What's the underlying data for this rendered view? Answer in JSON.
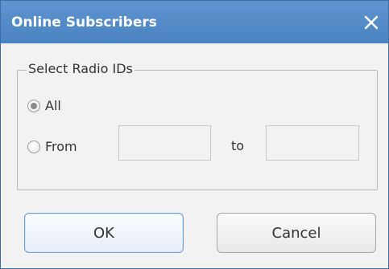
{
  "dialog": {
    "title": "Online Subscribers",
    "close_icon": "close-icon"
  },
  "group": {
    "legend": "Select Radio IDs",
    "options": [
      {
        "label": "All",
        "selected": true
      },
      {
        "label": "From",
        "selected": false
      }
    ],
    "from_value": "",
    "to_label": "to",
    "to_value": ""
  },
  "buttons": {
    "ok": "OK",
    "cancel": "Cancel"
  },
  "colors": {
    "titlebar": "#4a83c2",
    "background": "#f2f2f2",
    "ok_border": "#6b9fd6"
  }
}
